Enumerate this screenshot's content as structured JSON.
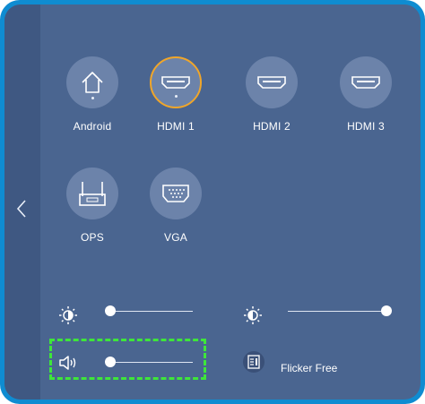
{
  "sources": [
    {
      "label": "Android",
      "icon": "home-icon",
      "selected": false
    },
    {
      "label": "HDMI 1",
      "icon": "hdmi-icon",
      "selected": true
    },
    {
      "label": "HDMI 2",
      "icon": "hdmi-icon",
      "selected": false
    },
    {
      "label": "HDMI 3",
      "icon": "hdmi-icon",
      "selected": false
    },
    {
      "label": "OPS",
      "icon": "ops-icon",
      "selected": false
    },
    {
      "label": "VGA",
      "icon": "vga-icon",
      "selected": false
    }
  ],
  "controls": {
    "brightness": {
      "icon": "brightness-icon",
      "level": 0
    },
    "contrast": {
      "icon": "contrast-icon",
      "level": 1
    },
    "volume": {
      "icon": "volume-icon",
      "level": 0
    },
    "flicker_free": {
      "icon": "flicker-free-icon",
      "label": "Flicker Free"
    }
  },
  "colors": {
    "frame": "#0f8cd1",
    "panel": "#4a6590",
    "sidebar": "#3f5882",
    "button": "#6c83aa",
    "selected_ring": "#f0a62a",
    "highlight": "#3ee63a"
  }
}
